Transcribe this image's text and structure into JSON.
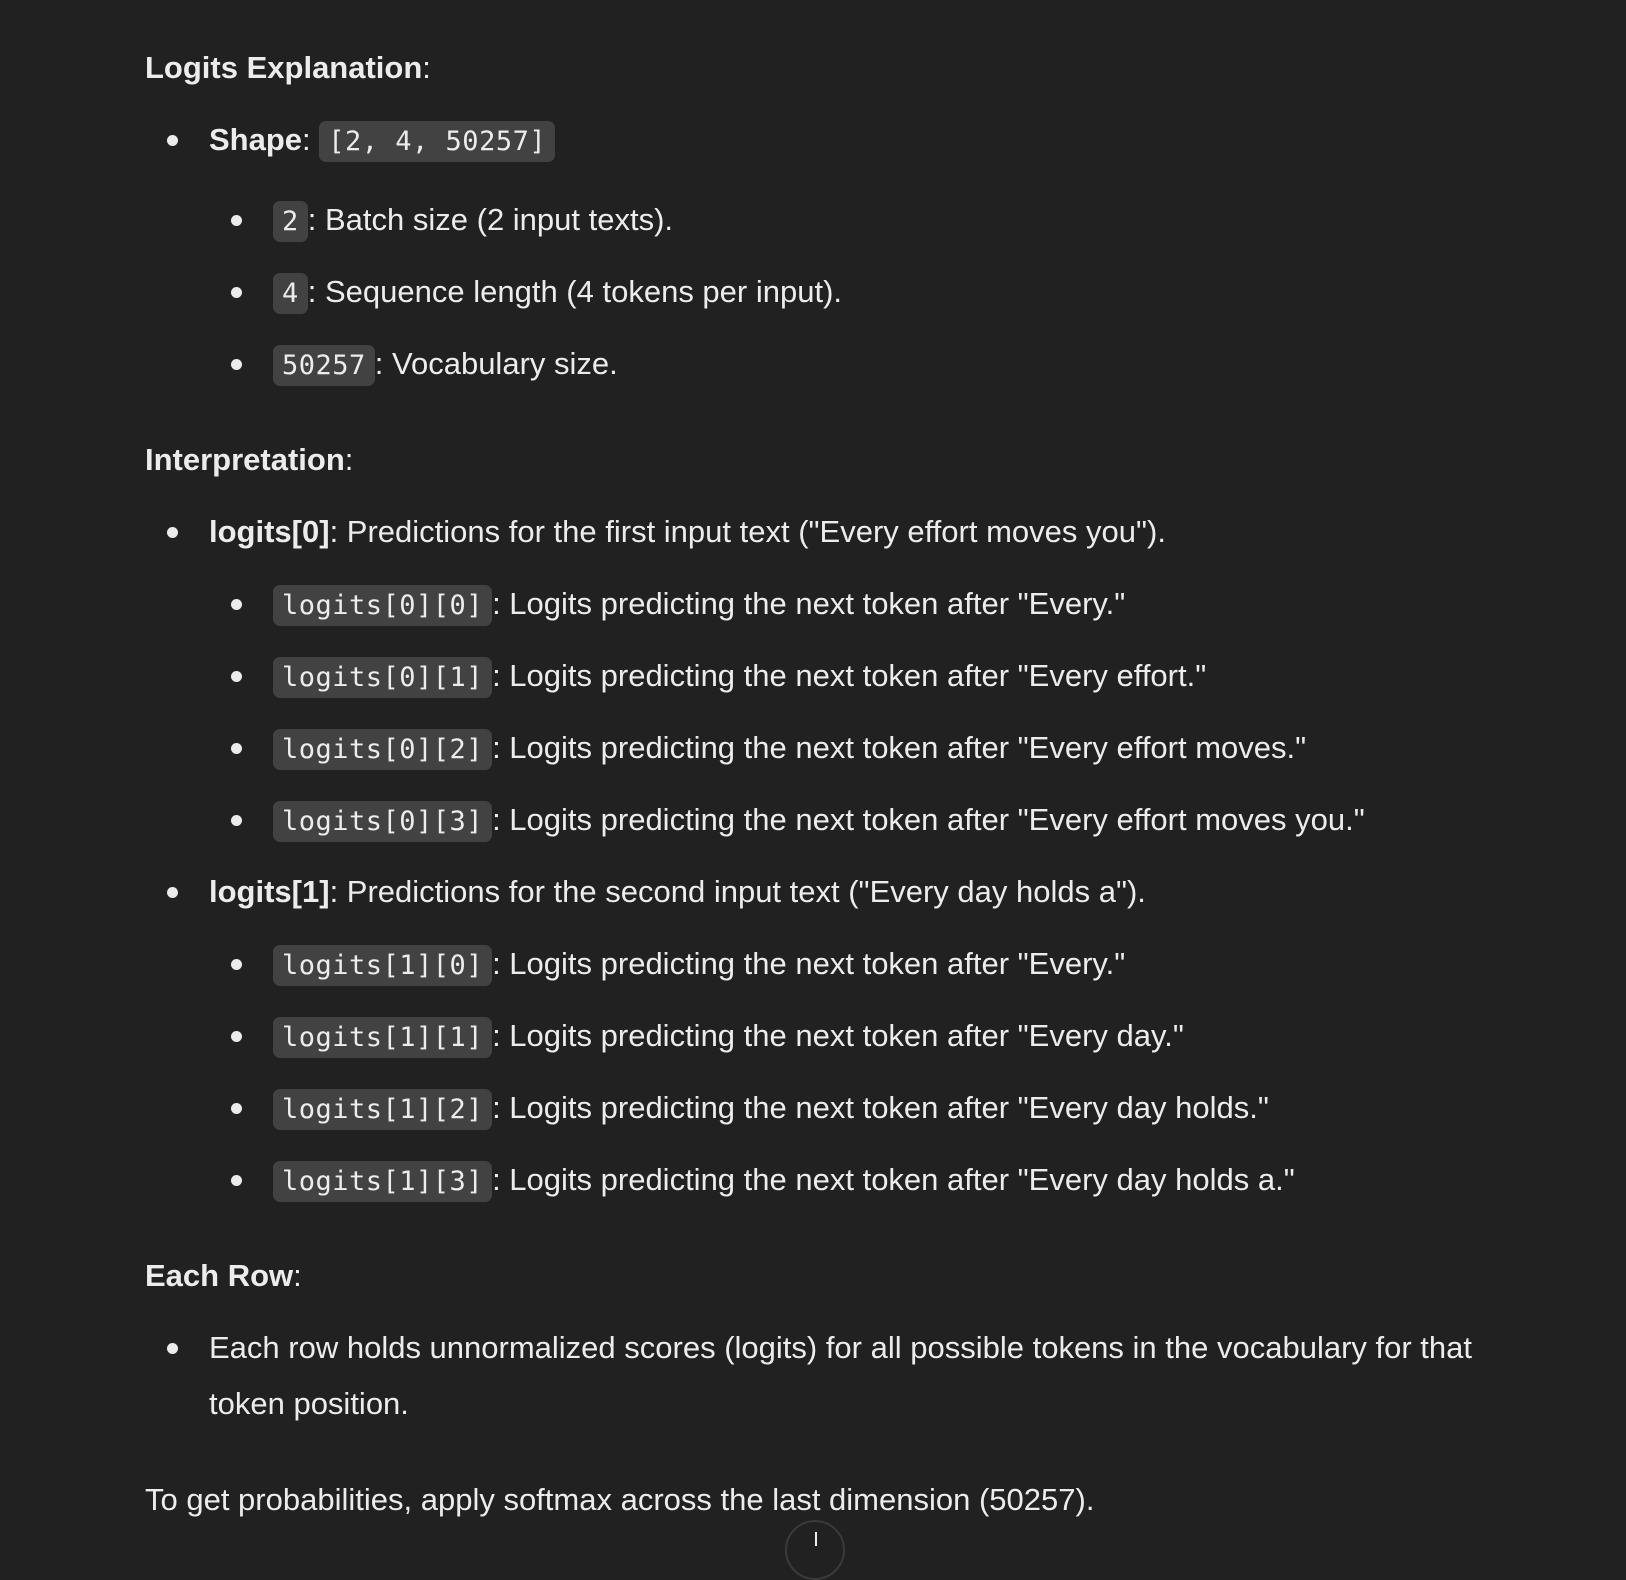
{
  "sections": {
    "logits_explanation": {
      "title": "Logits Explanation",
      "suffix": ":",
      "shape_label": "Shape",
      "shape_code": "[2, 4, 50257]",
      "dims": [
        {
          "code": "2",
          "text": ": Batch size (2 input texts)."
        },
        {
          "code": "4",
          "text": ": Sequence length (4 tokens per input)."
        },
        {
          "code": "50257",
          "text": ": Vocabulary size."
        }
      ]
    },
    "interpretation": {
      "title": "Interpretation",
      "suffix": ":",
      "groups": [
        {
          "label": "logits[0]",
          "text": ": Predictions for the first input text (\"Every effort moves you\").",
          "items": [
            {
              "code": "logits[0][0]",
              "text": ": Logits predicting the next token after \"Every.\""
            },
            {
              "code": "logits[0][1]",
              "text": ": Logits predicting the next token after \"Every effort.\""
            },
            {
              "code": "logits[0][2]",
              "text": ": Logits predicting the next token after \"Every effort moves.\""
            },
            {
              "code": "logits[0][3]",
              "text": ": Logits predicting the next token after \"Every effort moves you.\""
            }
          ]
        },
        {
          "label": "logits[1]",
          "text": ": Predictions for the second input text (\"Every day holds a\").",
          "items": [
            {
              "code": "logits[1][0]",
              "text": ": Logits predicting the next token after \"Every.\""
            },
            {
              "code": "logits[1][1]",
              "text": ": Logits predicting the next token after \"Every day.\""
            },
            {
              "code": "logits[1][2]",
              "text": ": Logits predicting the next token after \"Every day holds.\""
            },
            {
              "code": "logits[1][3]",
              "text": ": Logits predicting the next token after \"Every day holds a.\""
            }
          ]
        }
      ]
    },
    "each_row": {
      "title": "Each Row",
      "suffix": ":",
      "text": "Each row holds unnormalized scores (logits) for all possible tokens in the vocabulary for that token position."
    },
    "closing": "To get probabilities, apply softmax across the last dimension (50257)."
  },
  "scroll_button": {
    "icon": "arrow-down-icon"
  }
}
